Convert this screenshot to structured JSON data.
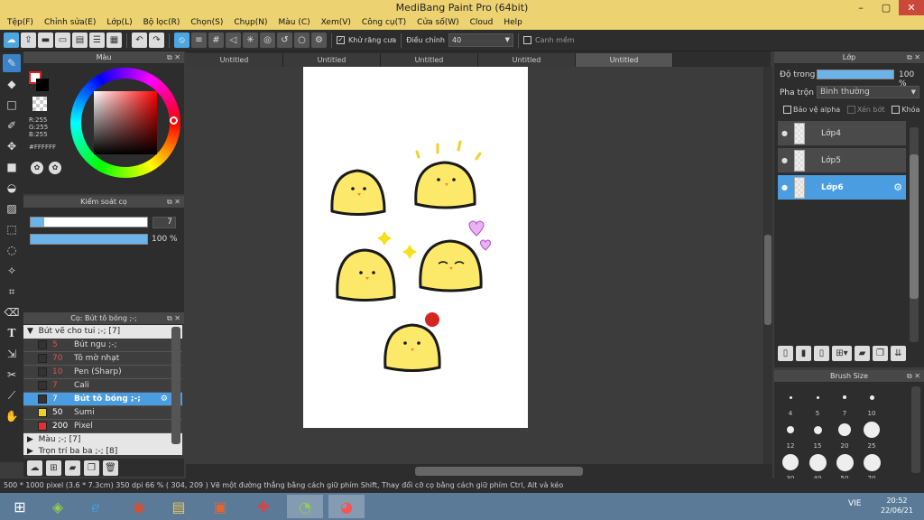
{
  "window": {
    "title": "MediBang Paint Pro (64bit)",
    "min": "–",
    "max": "▢",
    "close": "✕"
  },
  "menu": [
    "Tệp(F)",
    "Chỉnh sửa(E)",
    "Lớp(L)",
    "Bộ lọc(R)",
    "Chọn(S)",
    "Chụp(N)",
    "Màu (C)",
    "Xem(V)",
    "Công cụ(T)",
    "Cửa số(W)",
    "Cloud",
    "Help"
  ],
  "toolbar": {
    "antialias_label": "Khử răng cưa",
    "adjust_label": "Điều chỉnh",
    "adjust_value": "40",
    "edge_label": "Canh mềm"
  },
  "tabs": [
    "Untitled",
    "Untitled",
    "Untitled",
    "Untitled",
    "Untitled"
  ],
  "color_panel": {
    "title": "Màu",
    "r": "R:255",
    "g": "G:255",
    "b": "B:255",
    "hex": "#FFFFFF",
    "accent": "#e02020"
  },
  "brush_control": {
    "title": "Kiểm soát cọ",
    "size": "7",
    "opacity": "100 %",
    "size_fraction": 0.12,
    "opacity_fraction": 1.0
  },
  "brush_list": {
    "title": "Cọ: Bút tô bóng ;-;",
    "group1": "Bút vẽ cho tui ;-; [7]",
    "items": [
      {
        "num": "5",
        "name": "Bút ngu ;-;",
        "color": "#333333",
        "numcolor": "#e05050"
      },
      {
        "num": "70",
        "name": "Tô mờ nhạt",
        "color": "#333333",
        "numcolor": "#e05050"
      },
      {
        "num": "10",
        "name": "Pen (Sharp)",
        "color": "#333333",
        "numcolor": "#e05050"
      },
      {
        "num": "7",
        "name": "Cali",
        "color": "#333333",
        "numcolor": "#e05050"
      },
      {
        "num": "7",
        "name": "Bút tô bóng ;-;",
        "color": "#333333",
        "numcolor": "#e05050"
      },
      {
        "num": "50",
        "name": "Sumi",
        "color": "#f0d020",
        "numcolor": "#ffffff"
      },
      {
        "num": "200",
        "name": "Pixel",
        "color": "#e03030",
        "numcolor": "#ffffff"
      }
    ],
    "group2": "Màu ;-; [7]",
    "group3": "Trọn trí ba ba ;-; [8]"
  },
  "layer_panel": {
    "title": "Lớp",
    "opacity_label": "Độ trong",
    "opacity_value": "100 %",
    "blend_label": "Pha trộn",
    "blend_value": "Bình thường",
    "protect_alpha": "Bảo vệ alpha",
    "clip": "Xén bớt",
    "lock": "Khóa",
    "layers": [
      "Lớp4",
      "Lớp5",
      "Lớp6"
    ]
  },
  "brush_size": {
    "title": "Brush Size",
    "sizes": [
      "4",
      "5",
      "7",
      "10",
      "12",
      "15",
      "20",
      "25",
      "30",
      "40",
      "50",
      "70"
    ]
  },
  "status": {
    "text": "500 * 1000 pixel   (3.6 * 7.3cm)   350 dpi   66 %   ( 304, 209 )   Vẽ một đường thẳng bằng cách giữ phím Shift, Thay đổi cỡ cọ bằng cách giữ phím Ctrl, Alt và kéo"
  },
  "taskbar": {
    "lang": "VIE",
    "time": "20:52",
    "date": "22/06/21"
  }
}
